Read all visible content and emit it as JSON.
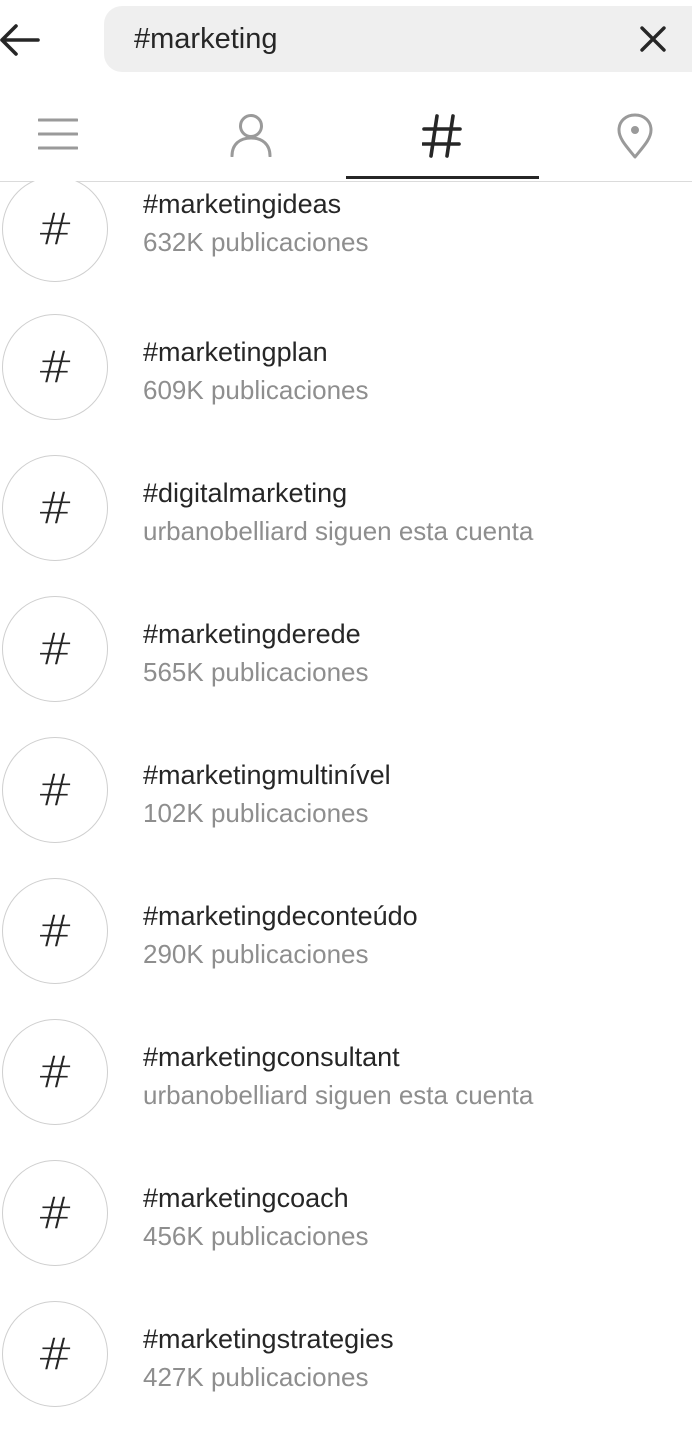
{
  "search": {
    "value": "#marketing",
    "back_icon": "arrow-left-icon",
    "clear_icon": "close-icon"
  },
  "tabs": [
    {
      "name": "top",
      "icon": "menu-lines-icon",
      "active": false
    },
    {
      "name": "accounts",
      "icon": "person-icon",
      "active": false
    },
    {
      "name": "tags",
      "icon": "hashtag-icon",
      "active": true
    },
    {
      "name": "places",
      "icon": "location-pin-icon",
      "active": false
    }
  ],
  "results": [
    {
      "title": "#marketingideas",
      "subtitle": "632K publicaciones"
    },
    {
      "title": "#marketingplan",
      "subtitle": "609K publicaciones"
    },
    {
      "title": "#digitalmarketing",
      "subtitle": "urbanobelliard siguen esta cuenta"
    },
    {
      "title": "#marketingderede",
      "subtitle": "565K publicaciones"
    },
    {
      "title": "#marketingmultinível",
      "subtitle": "102K publicaciones"
    },
    {
      "title": "#marketingdeconteúdo",
      "subtitle": "290K publicaciones"
    },
    {
      "title": "#marketingconsultant",
      "subtitle": "urbanobelliard siguen esta cuenta"
    },
    {
      "title": "#marketingcoach",
      "subtitle": "456K publicaciones"
    },
    {
      "title": "#marketingstrategies",
      "subtitle": "427K publicaciones"
    }
  ],
  "colors": {
    "text_primary": "#262626",
    "text_secondary": "#8e8e8e",
    "icon_inactive": "#9a9a9a",
    "search_bg": "#efefef"
  }
}
